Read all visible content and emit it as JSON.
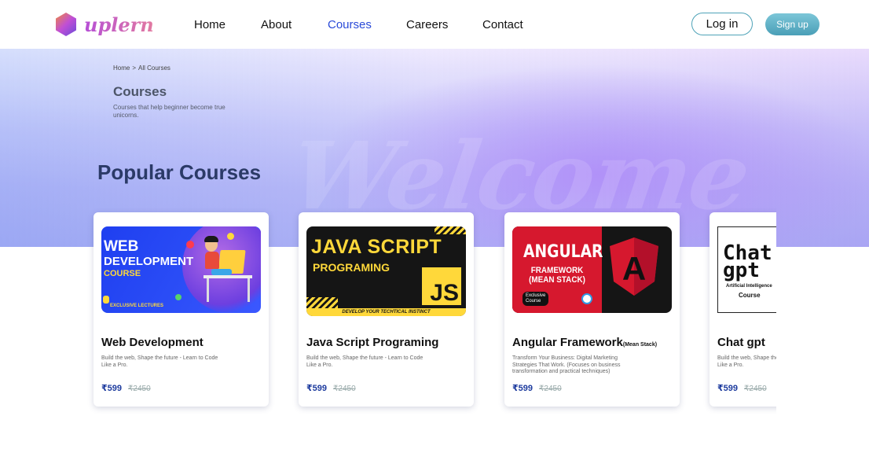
{
  "brand": {
    "name": "uplern"
  },
  "nav": {
    "items": [
      "Home",
      "About",
      "Courses",
      "Careers",
      "Contact"
    ],
    "active": "Courses"
  },
  "auth": {
    "login_label": "Log in",
    "signup_label": "Sign up"
  },
  "breadcrumb": {
    "home": "Home",
    "separator": ">",
    "current": "All Courses"
  },
  "hero": {
    "title": "Courses",
    "subtitle": "Courses that help beginner become true unicorns.",
    "watermark": "Welcome"
  },
  "section": {
    "title": "Popular Courses"
  },
  "courses": [
    {
      "title": "Web Development",
      "title_suffix": "",
      "description": "Build the web, Shape the future - Learn to Code Like a Pro.",
      "price": "₹599",
      "old_price": "₹2450",
      "thumb": {
        "line1": "WEB",
        "line2": "DEVELOPMENT",
        "line3": "COURSE",
        "tag": "EXCLUSIVE LECTURES"
      }
    },
    {
      "title": "Java Script Programing",
      "title_suffix": "",
      "description": "Build the web, Shape the future - Learn to Code Like a Pro.",
      "price": "₹599",
      "old_price": "₹2450",
      "thumb": {
        "line1": "JAVA SCRIPT",
        "line2": "PROGRAMING",
        "logo": "JS",
        "band": "DEVELOP YOUR TECHTICAL INSTINCT"
      }
    },
    {
      "title": "Angular Framework",
      "title_suffix": "(Mean Stack)",
      "description": "Transform Your Business: Digital Marketing Strategies That Work. (Focuses on business transformation and practical techniques)",
      "price": "₹599",
      "old_price": "₹2450",
      "thumb": {
        "line1": "ANGULAR",
        "line2": "FRAMEWORK",
        "line3": "(MEAN STACK)",
        "badge_1": "Exclusive",
        "badge_2": "Course",
        "logo": "A"
      }
    },
    {
      "title": "Chat gpt",
      "title_suffix": "",
      "description": "Build the web, Shape the future - Learn to Code Like a Pro.",
      "price": "₹599",
      "old_price": "₹2450",
      "thumb": {
        "line1": "Chat",
        "line2": "gpt",
        "line3": "Artificial Intelligence",
        "line4": "Course"
      }
    }
  ],
  "colors": {
    "accent": "#2a4ad8",
    "heading": "#2b3a67",
    "price": "#1d3b9e",
    "signup_button": "#4a9fb7"
  }
}
